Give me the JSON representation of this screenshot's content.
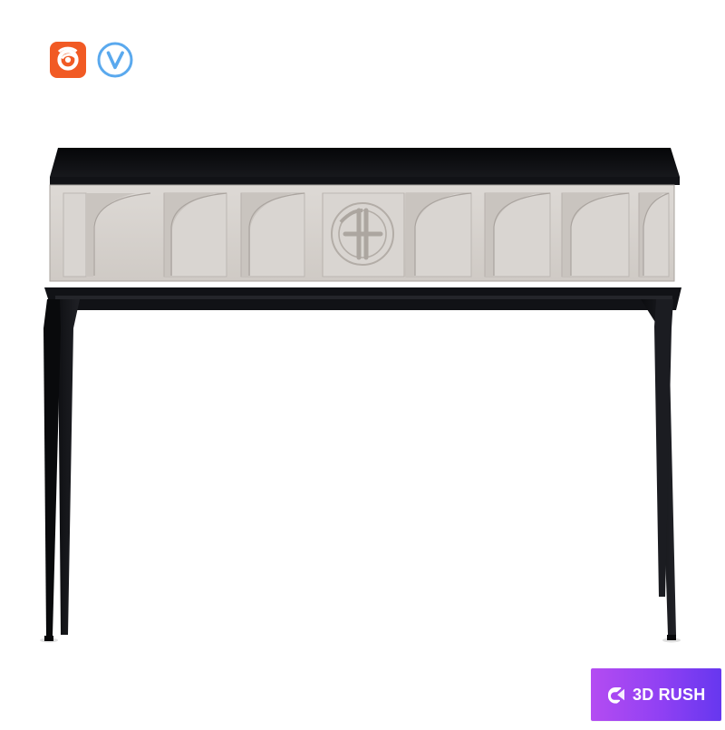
{
  "brand": {
    "label": "3D RUSH",
    "icon": "rush-logo-icon",
    "colors": {
      "start": "#b44cf2",
      "end": "#6637ef",
      "text": "#ffffff"
    }
  },
  "badges": {
    "corona": {
      "icon": "corona-renderer-icon",
      "color": "#f15a24"
    },
    "vray": {
      "icon": "vray-icon",
      "color": "#5aa9ee"
    }
  },
  "colors": {
    "top": "#0b0c0f",
    "frame": "#111216",
    "drawer": "#d7d3cf",
    "drawer_shadow": "#bdb8b3",
    "background": "#ffffff"
  }
}
